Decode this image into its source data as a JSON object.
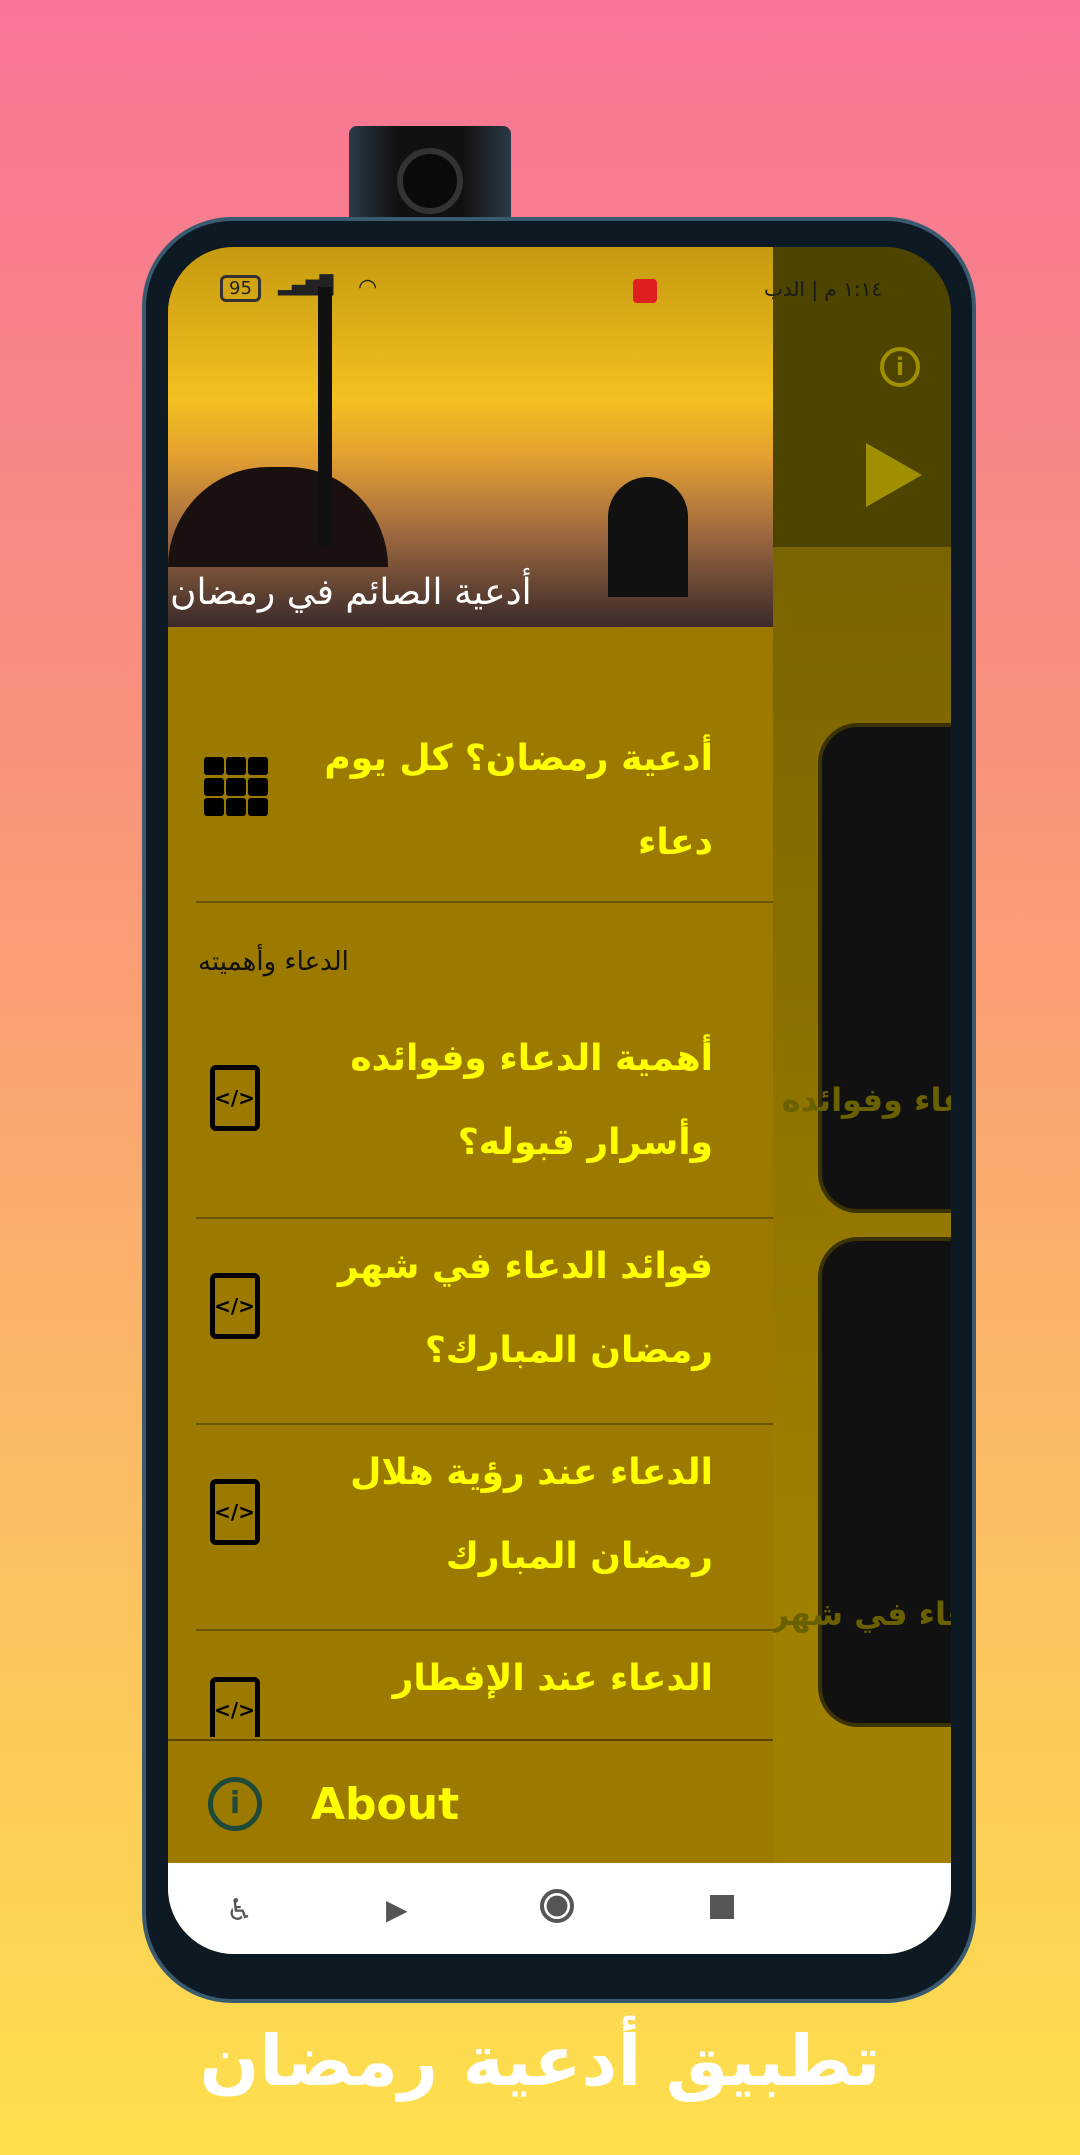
{
  "status_bar": {
    "battery": "95",
    "time": "١:١٤ م | الدب"
  },
  "header": {
    "banner_text": "أدعية الصائم في رمضان"
  },
  "drawer": {
    "top_item": "أدعية رمضان؟ كل يوم دعاء",
    "section_title": "الدعاء وأهميته",
    "items": [
      {
        "label": "أهمية الدعاء وفوائده وأسرار قبوله؟",
        "icon": "code-file-icon"
      },
      {
        "label": "فوائد الدعاء في شهر رمضان المبارك؟",
        "icon": "code-file-icon"
      },
      {
        "label": "الدعاء عند رؤية هلال رمضان المبارك",
        "icon": "code-file-icon"
      },
      {
        "label": "الدعاء عند الإفطار",
        "icon": "code-file-icon"
      }
    ],
    "about_label": "About"
  },
  "background_cards": [
    "أهمية الدعاء وفوائده وأسرار قبوله؟",
    "فوائد الدعاء في شهر رمضان المبارك؟"
  ],
  "caption": "تطبيق أدعية رمضان",
  "colors": {
    "drawer_bg": "#9c7a00",
    "menu_text": "#ffff00",
    "about_icon": "#1f4a3a"
  }
}
